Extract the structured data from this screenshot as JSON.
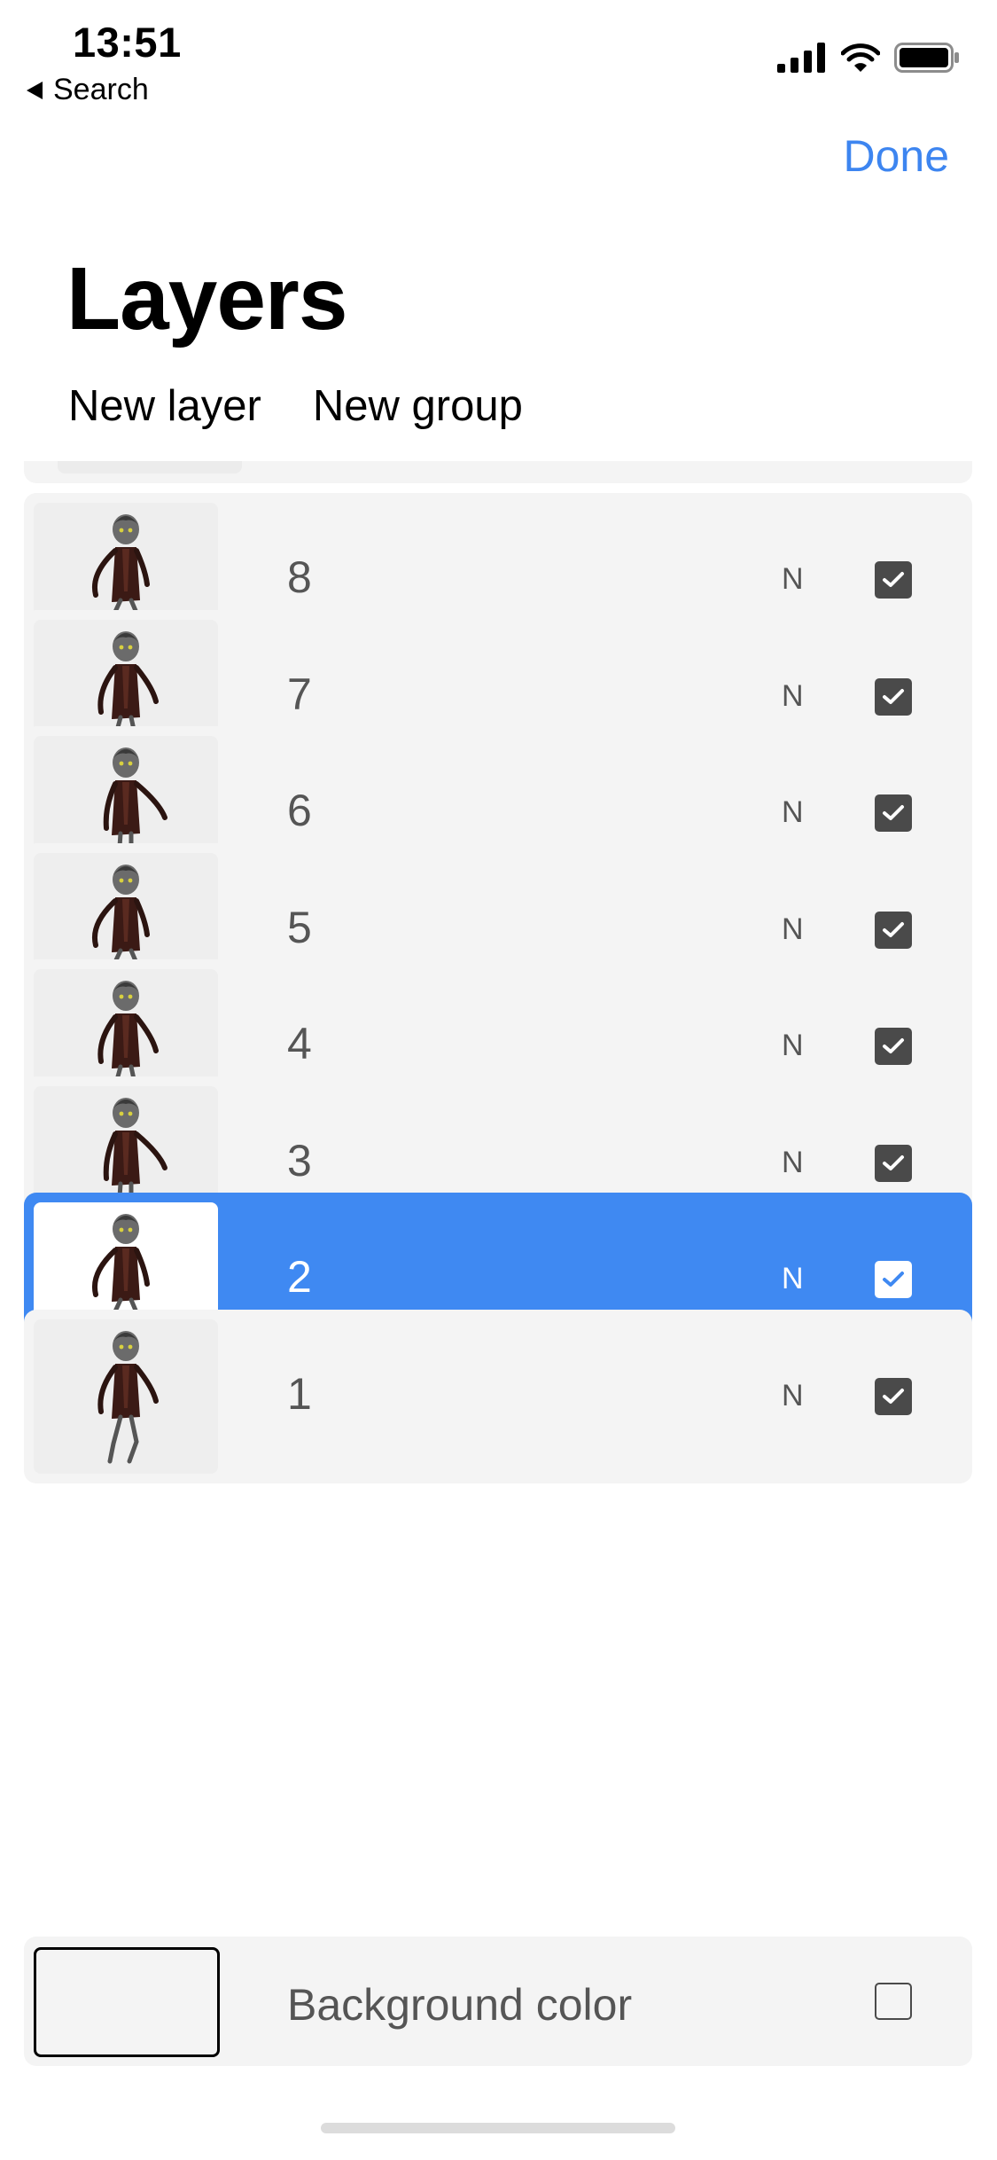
{
  "status_bar": {
    "time": "13:51",
    "back_label": "Search"
  },
  "header": {
    "done_label": "Done",
    "title": "Layers",
    "actions": {
      "new_layer": "New layer",
      "new_group": "New group"
    }
  },
  "layers": [
    {
      "name": "8",
      "mode": "N",
      "visible": true,
      "selected": false
    },
    {
      "name": "7",
      "mode": "N",
      "visible": true,
      "selected": false
    },
    {
      "name": "6",
      "mode": "N",
      "visible": true,
      "selected": false
    },
    {
      "name": "5",
      "mode": "N",
      "visible": true,
      "selected": false
    },
    {
      "name": "4",
      "mode": "N",
      "visible": true,
      "selected": false
    },
    {
      "name": "3",
      "mode": "N",
      "visible": true,
      "selected": false
    },
    {
      "name": "2",
      "mode": "N",
      "visible": true,
      "selected": true
    },
    {
      "name": "1",
      "mode": "N",
      "visible": true,
      "selected": false
    }
  ],
  "background": {
    "label": "Background color",
    "visible": false
  },
  "colors": {
    "accent": "#3d85f0",
    "selected_row": "#3f89f2",
    "row_bg": "#f4f4f4",
    "checkbox": "#4a4a4a"
  }
}
